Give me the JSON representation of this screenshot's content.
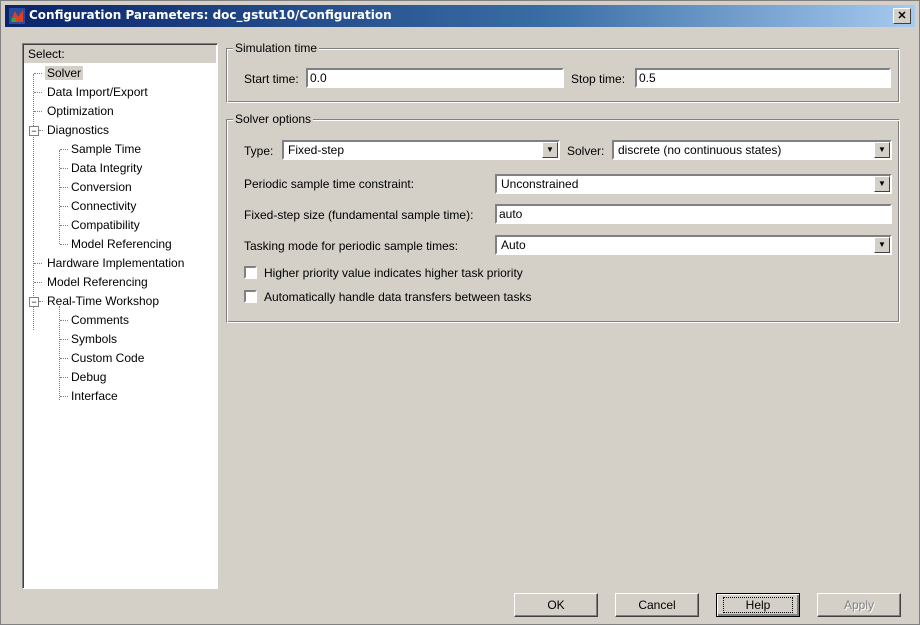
{
  "window": {
    "title": "Configuration Parameters: doc_gstut10/Configuration",
    "close_symbol": "✕",
    "app_icon": "simulink-icon"
  },
  "tree": {
    "header": "Select:",
    "items": [
      {
        "label": "Solver",
        "selected": true
      },
      {
        "label": "Data Import/Export"
      },
      {
        "label": "Optimization"
      },
      {
        "label": "Diagnostics",
        "expanded": true,
        "expander": "−"
      },
      {
        "label": "Sample Time"
      },
      {
        "label": "Data Integrity"
      },
      {
        "label": "Conversion"
      },
      {
        "label": "Connectivity"
      },
      {
        "label": "Compatibility"
      },
      {
        "label": "Model Referencing"
      },
      {
        "label": "Hardware Implementation"
      },
      {
        "label": "Model Referencing"
      },
      {
        "label": "Real-Time Workshop",
        "expanded": true,
        "expander": "−"
      },
      {
        "label": "Comments"
      },
      {
        "label": "Symbols"
      },
      {
        "label": "Custom Code"
      },
      {
        "label": "Debug"
      },
      {
        "label": "Interface"
      }
    ]
  },
  "simulation_time": {
    "legend": "Simulation time",
    "start_label": "Start time:",
    "start_value": "0.0",
    "stop_label": "Stop time:",
    "stop_value": "0.5"
  },
  "solver_options": {
    "legend": "Solver options",
    "type_label": "Type:",
    "type_value": "Fixed-step",
    "solver_label": "Solver:",
    "solver_value": "discrete (no continuous states)",
    "periodic_label": "Periodic sample time constraint:",
    "periodic_value": "Unconstrained",
    "fixed_step_label": "Fixed-step size (fundamental sample time):",
    "fixed_step_value": "auto",
    "tasking_label": "Tasking mode for periodic sample times:",
    "tasking_value": "Auto",
    "higher_priority_label": "Higher priority value indicates higher task priority",
    "higher_priority_checked": false,
    "auto_transfer_label": "Automatically handle data transfers between tasks",
    "auto_transfer_checked": false,
    "dropdown_arrow": "▼"
  },
  "buttons": {
    "ok": "OK",
    "cancel": "Cancel",
    "help": "Help",
    "apply": "Apply"
  }
}
